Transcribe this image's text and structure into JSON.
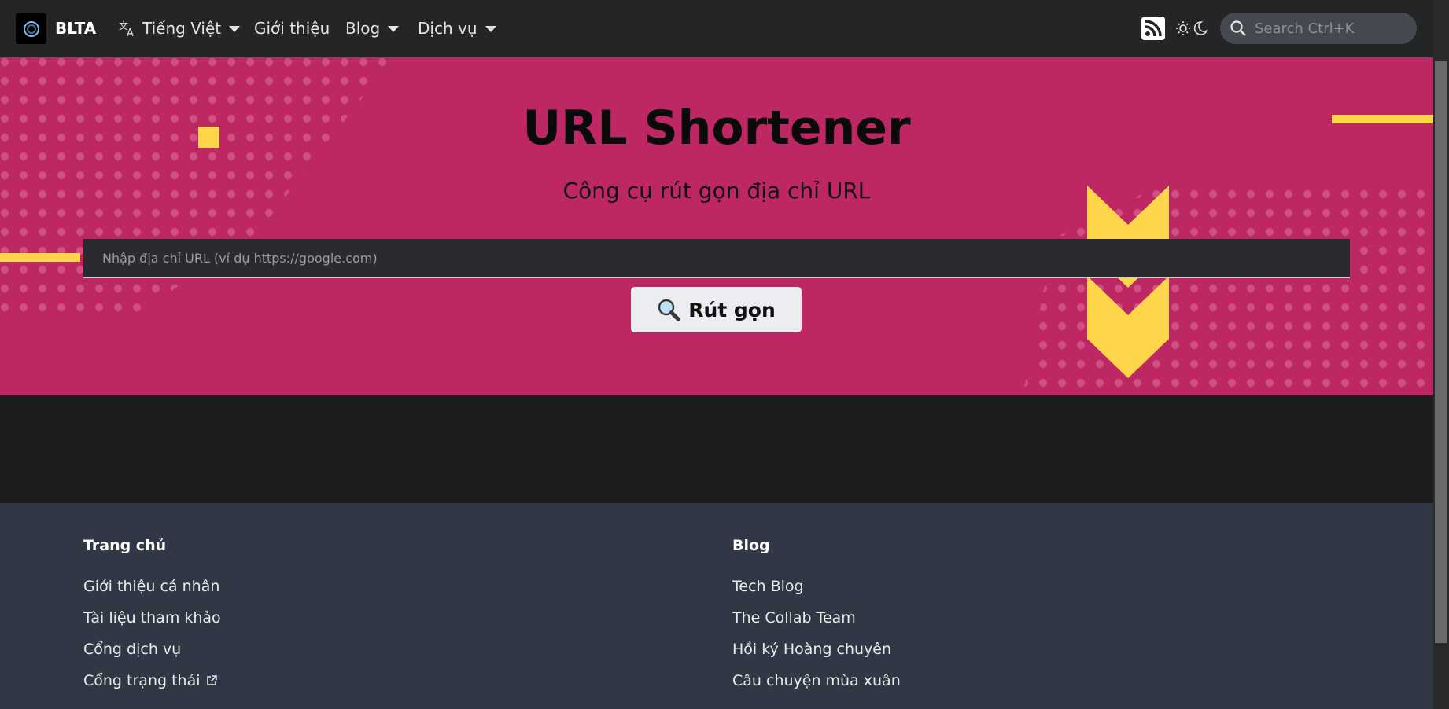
{
  "nav": {
    "brand": "BLTA",
    "language": "Tiếng Việt",
    "about": "Giới thiệu",
    "blog": "Blog",
    "services": "Dịch vụ",
    "search_placeholder": "Search Ctrl+K"
  },
  "hero": {
    "title": "URL Shortener",
    "subtitle": "Công cụ rút gọn địa chỉ URL",
    "input_placeholder": "Nhập địa chỉ URL (ví dụ https://google.com)",
    "input_value": "",
    "button_label": "Rút gọn"
  },
  "footer": {
    "col1": {
      "heading": "Trang chủ",
      "links": [
        "Giới thiệu cá nhân",
        "Tài liệu tham khảo",
        "Cổng dịch vụ",
        "Cổng trạng thái"
      ]
    },
    "col2": {
      "heading": "Blog",
      "links": [
        "Tech Blog",
        "The Collab Team",
        "Hồi ký Hoàng chuyên",
        "Câu chuyện mùa xuân"
      ]
    }
  },
  "colors": {
    "hero_bg": "#bc2764",
    "accent_yellow": "#ffd54a",
    "navbar_bg": "#242526",
    "footer_bg": "#303846"
  },
  "icons": [
    "logo-icon",
    "translate-icon",
    "rss-icon",
    "sun-icon",
    "moon-icon",
    "search-icon",
    "magnifier-emoji-icon",
    "external-link-icon"
  ]
}
